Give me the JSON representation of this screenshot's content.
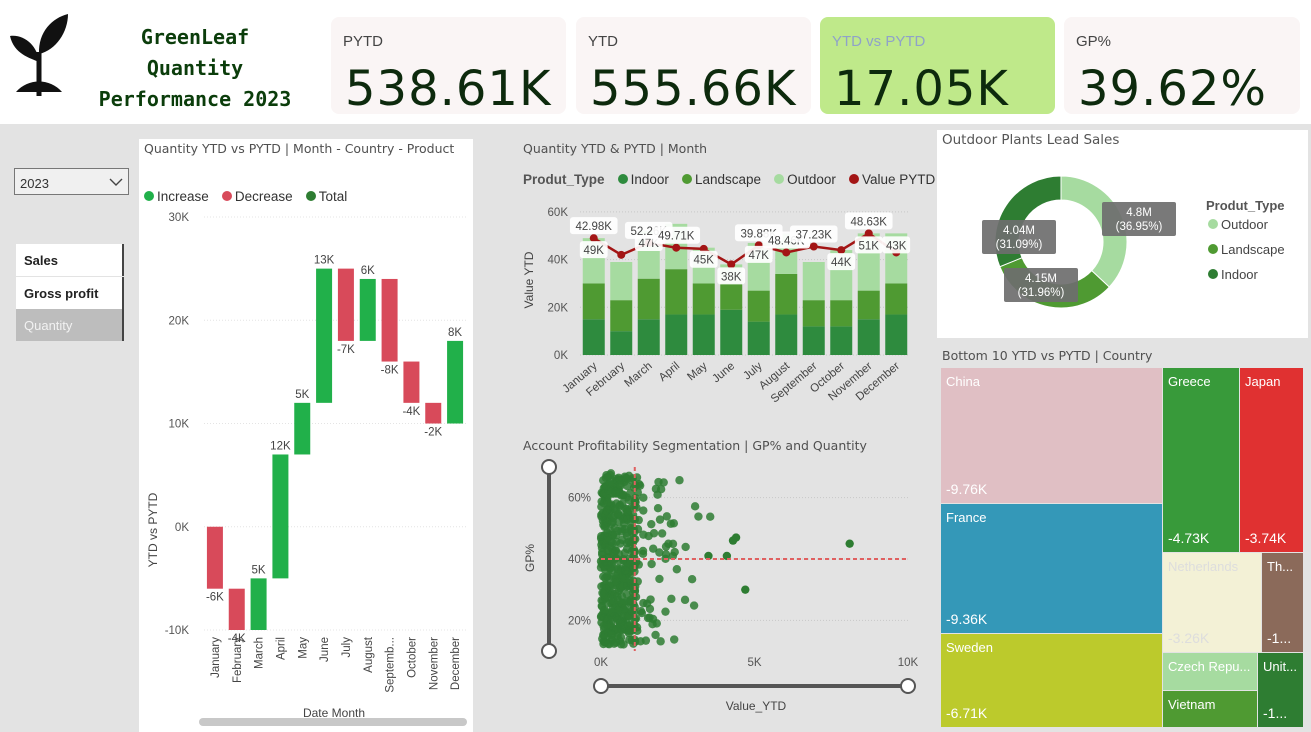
{
  "brand": {
    "line1": "GreenLeaf",
    "line2": "Quantity",
    "line3": "Performance 2023"
  },
  "kpis": [
    {
      "label": "PYTD",
      "value": "538.61K",
      "bg": "#faf5f5",
      "label_color": "#444444"
    },
    {
      "label": "YTD",
      "value": "555.66K",
      "bg": "#faf5f5",
      "label_color": "#444444"
    },
    {
      "label": "YTD vs PYTD",
      "value": "17.05K",
      "bg": "#bfe98a",
      "label_color": "#8fa2c9"
    },
    {
      "label": "GP%",
      "value": "39.62%",
      "bg": "#faf5f5",
      "label_color": "#444444"
    }
  ],
  "year_select": {
    "value": "2023"
  },
  "nav": {
    "items": [
      "Sales",
      "Gross profit",
      "Quantity"
    ],
    "active": "Quantity"
  },
  "waterfall": {
    "title": "Quantity YTD vs PYTD | Month - Country - Product",
    "legend": [
      "Increase",
      "Decrease",
      "Total"
    ],
    "ylabel": "YTD vs PYTD",
    "xlabel": "Date Month",
    "yticks": [
      "30K",
      "20K",
      "10K",
      "0K",
      "-10K"
    ],
    "months": [
      "January",
      "February",
      "March",
      "April",
      "May",
      "June",
      "July",
      "August",
      "Septemb...",
      "October",
      "November",
      "December"
    ]
  },
  "combo": {
    "title": "Quantity YTD & PYTD | Month",
    "legend_title": "Produt_Type",
    "legend": [
      "Indoor",
      "Landscape",
      "Outdoor",
      "Value PYTD"
    ],
    "ylabel": "Value YTD",
    "yticks": [
      "60K",
      "40K",
      "20K",
      "0K"
    ],
    "months": [
      "January",
      "February",
      "March",
      "April",
      "May",
      "June",
      "July",
      "August",
      "September",
      "October",
      "November",
      "December"
    ]
  },
  "donut": {
    "title": "Outdoor Plants Lead Sales",
    "legend_title": "Produt_Type",
    "labels": [
      {
        "name": "Outdoor",
        "value": "4.8M",
        "pct": "(36.95%)"
      },
      {
        "name": "Landscape",
        "value": "4.15M",
        "pct": "(31.96%)"
      },
      {
        "name": "Indoor",
        "value": "4.04M",
        "pct": "(31.09%)"
      }
    ]
  },
  "scatter": {
    "title": "Account Profitability Segmentation | GP% and Quantity",
    "ylabel": "GP%",
    "xlabel": "Value_YTD",
    "yticks": [
      "60%",
      "40%",
      "20%"
    ],
    "xticks": [
      "0K",
      "5K",
      "10K"
    ]
  },
  "treemap": {
    "title": "Bottom 10 YTD vs PYTD | Country",
    "cells": [
      {
        "name": "China",
        "value": "-9.76K"
      },
      {
        "name": "France",
        "value": "-9.36K"
      },
      {
        "name": "Sweden",
        "value": "-6.71K"
      },
      {
        "name": "Greece",
        "value": "-4.73K"
      },
      {
        "name": "Japan",
        "value": "-3.74K"
      },
      {
        "name": "Netherlands",
        "value": "-3.26K"
      },
      {
        "name": "Th...",
        "value": "-1..."
      },
      {
        "name": "Czech Repu...",
        "value": ""
      },
      {
        "name": "Vietnam",
        "value": ""
      },
      {
        "name": "Unit...",
        "value": "-1..."
      }
    ]
  },
  "chart_data": [
    {
      "type": "bar",
      "chart": "waterfall",
      "categories": [
        "January",
        "February",
        "March",
        "April",
        "May",
        "June",
        "July",
        "August",
        "Septemb...",
        "October",
        "November",
        "December"
      ],
      "values": [
        -6000,
        -4000,
        5000,
        12000,
        5000,
        13000,
        -7000,
        6000,
        -8000,
        -4000,
        -2000,
        8000
      ],
      "data_labels": [
        "-6K",
        "-4K",
        "5K",
        "12K",
        "5K",
        "13K",
        "-7K",
        "6K",
        "-8K",
        "-4K",
        "-2K",
        "8K"
      ],
      "ylim": [
        -10000,
        30000
      ],
      "colors": {
        "increase": "#21b04a",
        "decrease": "#d84a5a",
        "total": "#2e7d32"
      }
    },
    {
      "type": "bar",
      "chart": "combo-stacked",
      "categories": [
        "January",
        "February",
        "March",
        "April",
        "May",
        "June",
        "July",
        "August",
        "September",
        "October",
        "November",
        "December"
      ],
      "series": [
        {
          "name": "Indoor",
          "values": [
            15000,
            10000,
            15000,
            17000,
            17000,
            19000,
            14000,
            17000,
            12000,
            12000,
            15000,
            17000
          ]
        },
        {
          "name": "Landscape",
          "values": [
            15000,
            13000,
            17000,
            19000,
            13000,
            11000,
            13000,
            17000,
            11000,
            11000,
            12000,
            13000
          ]
        },
        {
          "name": "Outdoor",
          "values": [
            19000,
            16000,
            20000,
            19000,
            15000,
            8000,
            20000,
            17000,
            16000,
            21000,
            24000,
            21000
          ]
        }
      ],
      "line": {
        "name": "Value PYTD",
        "values": [
          49000,
          42000,
          47000,
          45000,
          44500,
          38000,
          46000,
          43000,
          45500,
          44000,
          51000,
          43000
        ]
      },
      "bar_labels": [
        "49K",
        "",
        "47K",
        "",
        "45K",
        "38K",
        "47K",
        "",
        "",
        "44K",
        "51K",
        "43K"
      ],
      "line_labels": [
        "42.98K",
        "",
        "52.26K",
        "49.71K",
        "",
        "",
        "39.88K",
        "48.46K",
        "37.23K",
        "",
        "48.63K",
        ""
      ],
      "ylim": [
        0,
        65000
      ],
      "colors": {
        "Indoor": "#2e8b3e",
        "Landscape": "#4f9a32",
        "Outdoor": "#a6dba0",
        "Value PYTD": "#a31515"
      }
    },
    {
      "type": "pie",
      "chart": "donut",
      "categories": [
        "Outdoor",
        "Landscape",
        "Indoor"
      ],
      "values": [
        4.8,
        4.15,
        4.04
      ],
      "percent": [
        36.95,
        31.96,
        31.09
      ],
      "colors": {
        "Outdoor": "#a6dba0",
        "Landscape": "#4f9a32",
        "Indoor": "#2e7d32"
      }
    },
    {
      "type": "scatter",
      "chart": "gp-vs-value",
      "xlim": [
        0,
        10000
      ],
      "ylim": [
        10,
        70
      ],
      "reference": {
        "x": 1100,
        "y": 40
      },
      "outliers": [
        {
          "x": 4700,
          "y": 30
        },
        {
          "x": 8100,
          "y": 45
        },
        {
          "x": 4300,
          "y": 46
        },
        {
          "x": 4400,
          "y": 47
        },
        {
          "x": 4100,
          "y": 41
        },
        {
          "x": 3500,
          "y": 41
        }
      ],
      "color": "#2e7d32"
    },
    {
      "type": "table",
      "chart": "treemap",
      "categories": [
        "China",
        "France",
        "Sweden",
        "Greece",
        "Japan",
        "Netherlands",
        "Th...",
        "Czech Repu...",
        "Vietnam",
        "Unit..."
      ],
      "values": [
        -9760,
        -9360,
        -6710,
        -4730,
        -3740,
        -3260,
        -1500,
        -1400,
        -1300,
        -1200
      ],
      "colors": {
        "China": "#e0bfc4",
        "France": "#3498b8",
        "Sweden": "#bcca2c",
        "Greece": "#389a3a",
        "Japan": "#e03131",
        "Netherlands": "#f3f1d6",
        "Th...": "#8b6a5a",
        "Czech Repu...": "#a6dba0",
        "Vietnam": "#4f9a32",
        "Unit...": "#2e7d32"
      }
    }
  ]
}
